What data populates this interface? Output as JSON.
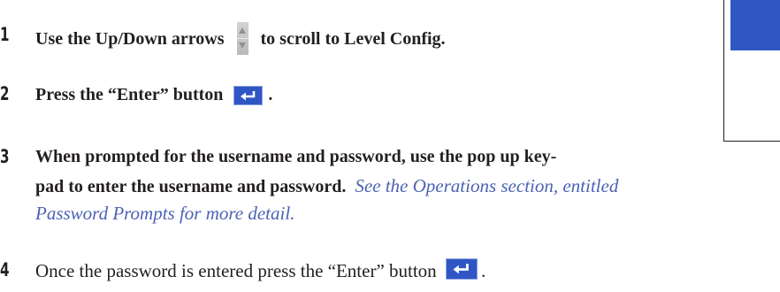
{
  "steps": [
    {
      "number": "1",
      "text_before": "Use the Up/Down arrows",
      "icon": "up-down-arrows-icon",
      "text_after": "to scroll to Level Config."
    },
    {
      "number": "2",
      "text_before": "Press the “Enter” button",
      "icon": "enter-key-icon",
      "text_after": "."
    },
    {
      "number": "3",
      "line1": "When prompted for the username and password, use the pop up key-",
      "line2_bold": "pad to enter the username and password.",
      "line2_link": "See the Operations section, entitled",
      "line3_link": "Password Prompts for more detail."
    },
    {
      "number": "4",
      "text_before": "Once the password is entered press the “Enter” button",
      "icon": "enter-key-icon",
      "text_after": "."
    }
  ],
  "colors": {
    "enter_button": "#2f56c4",
    "link_text": "#4b62b5",
    "arrow_button": "#c4c6c8"
  }
}
